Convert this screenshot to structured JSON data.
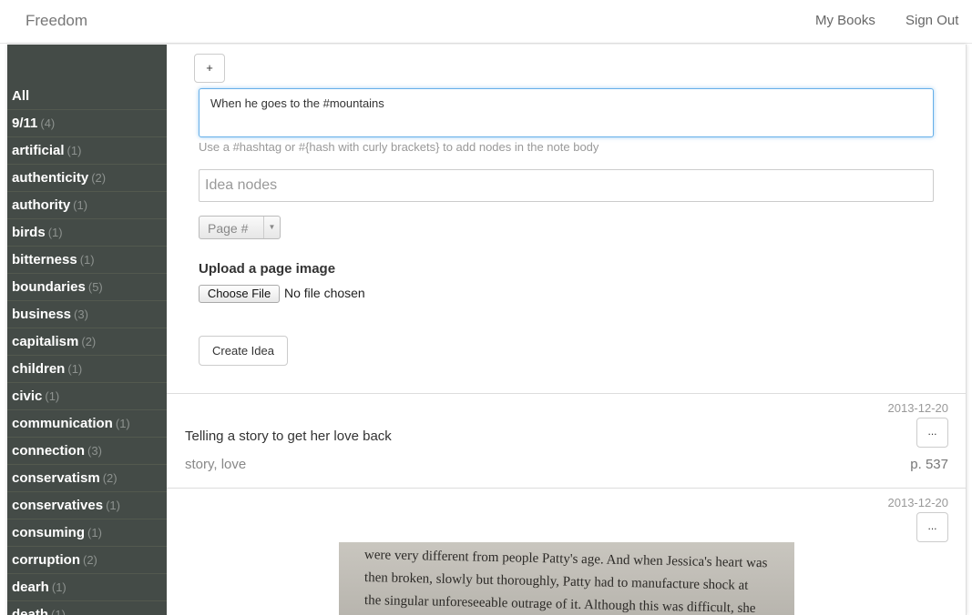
{
  "nav": {
    "brand": "Freedom",
    "my_books": "My Books",
    "sign_out": "Sign Out"
  },
  "sidebar": {
    "items": [
      {
        "label": "All",
        "count": ""
      },
      {
        "label": "9/11",
        "count": "(4)"
      },
      {
        "label": "artificial",
        "count": "(1)"
      },
      {
        "label": "authenticity",
        "count": "(2)"
      },
      {
        "label": "authority",
        "count": "(1)"
      },
      {
        "label": "birds",
        "count": "(1)"
      },
      {
        "label": "bitterness",
        "count": "(1)"
      },
      {
        "label": "boundaries",
        "count": "(5)"
      },
      {
        "label": "business",
        "count": "(3)"
      },
      {
        "label": "capitalism",
        "count": "(2)"
      },
      {
        "label": "children",
        "count": "(1)"
      },
      {
        "label": "civic",
        "count": "(1)"
      },
      {
        "label": "communication",
        "count": "(1)"
      },
      {
        "label": "connection",
        "count": "(3)"
      },
      {
        "label": "conservatism",
        "count": "(2)"
      },
      {
        "label": "conservatives",
        "count": "(1)"
      },
      {
        "label": "consuming",
        "count": "(1)"
      },
      {
        "label": "corruption",
        "count": "(2)"
      },
      {
        "label": "dearh",
        "count": "(1)"
      },
      {
        "label": "death",
        "count": "(1)"
      }
    ]
  },
  "form": {
    "plus_label": "+",
    "note_value": "When he goes to the #mountains",
    "hint": "Use a #hashtag or #{hash with curly brackets} to add nodes in the note body",
    "idea_nodes_placeholder": "Idea nodes",
    "page_select": "Page #",
    "upload_label": "Upload a page image",
    "choose_file": "Choose File",
    "no_file": "No file chosen",
    "create_button": "Create Idea"
  },
  "notes": [
    {
      "date": "2013-12-20",
      "more": "...",
      "text": "Telling a story to get her love back",
      "tags": "story, love",
      "page": "p. 537"
    },
    {
      "date": "2013-12-20",
      "more": "...",
      "image_lines": [
        "were very different from people Patty's age. And when Jessica's heart was",
        "then broken, slowly but thoroughly, Patty had to manufacture shock at",
        "the singular unforeseeable outrage of it. Although this was difficult, she"
      ]
    }
  ]
}
